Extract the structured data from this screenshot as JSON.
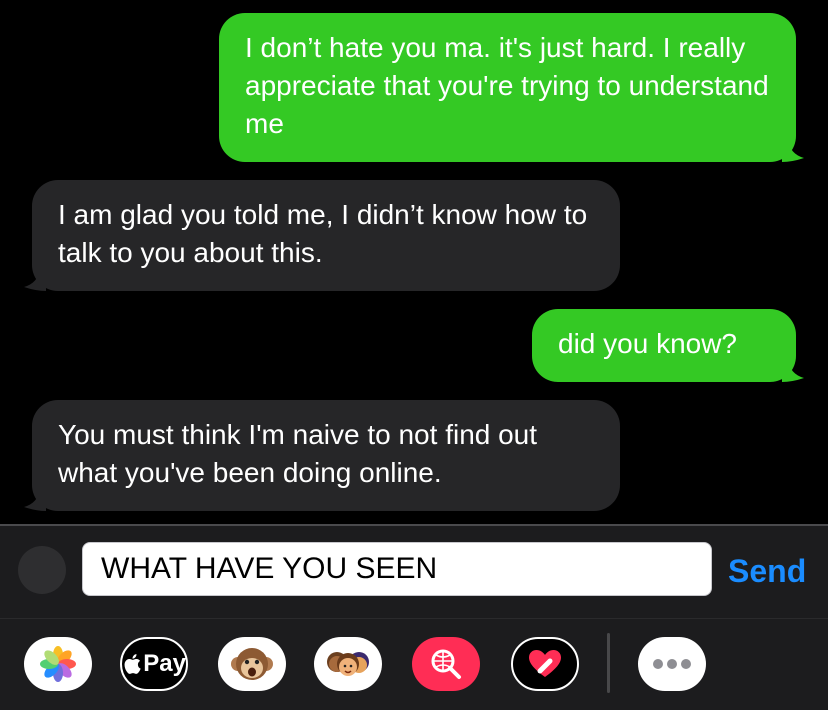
{
  "messages": [
    {
      "direction": "sent",
      "text": "I don’t hate you ma. it's just hard. I really appreciate that you're trying to understand me"
    },
    {
      "direction": "received",
      "text": "I am glad you told me, I didn’t know how to talk to you about this."
    },
    {
      "direction": "sent",
      "text": "did you know?"
    },
    {
      "direction": "received",
      "text": "You must think I'm naive to not find out what you've been doing online."
    }
  ],
  "compose": {
    "input_value": "WHAT HAVE YOU SEEN",
    "send_label": "Send"
  },
  "app_strip": {
    "items": [
      {
        "name": "photos-app-icon"
      },
      {
        "name": "apple-pay-icon",
        "label": "Pay"
      },
      {
        "name": "animoji-icon"
      },
      {
        "name": "memoji-stickers-icon"
      },
      {
        "name": "image-search-icon"
      },
      {
        "name": "digital-touch-icon"
      },
      {
        "name": "more-apps-icon"
      }
    ]
  },
  "colors": {
    "sent_bubble": "#34C924",
    "received_bubble": "#262628",
    "send_button": "#1a8cff",
    "background": "#000000"
  }
}
